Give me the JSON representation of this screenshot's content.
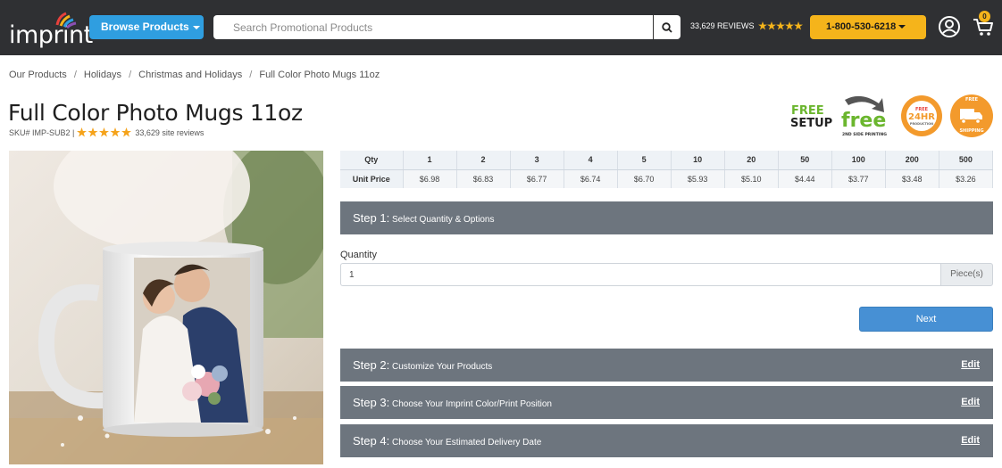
{
  "header": {
    "logo_text": "imprint",
    "browse_label": "Browse Products",
    "search_placeholder": "Search Promotional Products",
    "reviews_text": "33,629 REVIEWS",
    "phone_label": "1-800-530-6218",
    "cart_count": "0",
    "colors": {
      "bar": "#2f3033",
      "browse": "#2f9ee0",
      "phone": "#f5b41b"
    }
  },
  "breadcrumb": [
    "Our Products",
    "Holidays",
    "Christmas and Holidays",
    "Full Color Photo Mugs 11oz"
  ],
  "breadcrumb_sep": "/",
  "product": {
    "title": "Full Color Photo Mugs 11oz",
    "sku": "SKU# IMP-SUB2 |",
    "rating_stars": 5,
    "site_reviews": "33,629 site reviews"
  },
  "badges": {
    "free_setup_top": "FREE",
    "free_setup_bottom": "SETUP",
    "free_word": "free",
    "second_side": "2ND SIDE PRINTING",
    "hr_free": "FREE",
    "hr_24": "24HR",
    "hr_production": "PRODUCTION",
    "ship_free": "FREE",
    "ship_label": "SHIPPING"
  },
  "price_table": {
    "qty_label": "Qty",
    "price_label": "Unit Price",
    "quantities": [
      "1",
      "2",
      "3",
      "4",
      "5",
      "10",
      "20",
      "50",
      "100",
      "200",
      "500"
    ],
    "prices": [
      "$6.98",
      "$6.83",
      "$6.77",
      "$6.74",
      "$6.70",
      "$5.93",
      "$5.10",
      "$4.44",
      "$3.77",
      "$3.48",
      "$3.26"
    ]
  },
  "steps": [
    {
      "num": "Step 1:",
      "label": "Select Quantity & Options",
      "edit": ""
    },
    {
      "num": "Step 2:",
      "label": "Customize Your Products",
      "edit": "Edit"
    },
    {
      "num": "Step 3:",
      "label": "Choose Your Imprint Color/Print Position",
      "edit": "Edit"
    },
    {
      "num": "Step 4:",
      "label": "Choose Your Estimated Delivery Date",
      "edit": "Edit"
    }
  ],
  "quantity": {
    "label": "Quantity",
    "value": "1",
    "addon": "Piece(s)",
    "next_label": "Next"
  }
}
